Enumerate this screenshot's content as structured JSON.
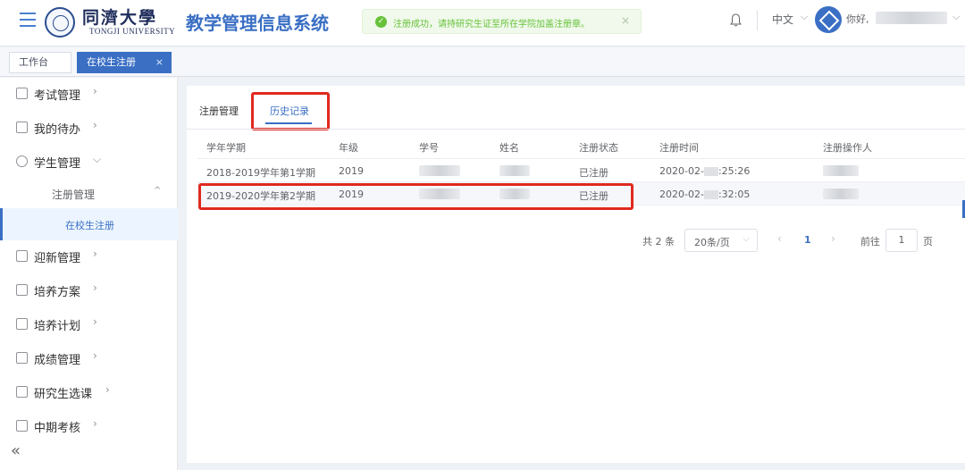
{
  "header": {
    "logo_cn": "同濟大學",
    "logo_en": "TONGJI UNIVERSITY",
    "system_title": "教学管理信息系统",
    "toast": "注册成功，请持研究生证至所在学院加盖注册章。",
    "language": "中文",
    "greeting": "你好,"
  },
  "tabs": [
    {
      "label": "工作台"
    },
    {
      "label": "在校生注册"
    }
  ],
  "sidebar": {
    "items": [
      {
        "label": "考试管理"
      },
      {
        "label": "我的待办"
      },
      {
        "label": "学生管理"
      },
      {
        "label": "迎新管理"
      },
      {
        "label": "培养方案"
      },
      {
        "label": "培养计划"
      },
      {
        "label": "成绩管理"
      },
      {
        "label": "研究生选课"
      },
      {
        "label": "中期考核"
      }
    ],
    "sub_item": "注册管理",
    "leaf_item": "在校生注册",
    "collapse": "«"
  },
  "main": {
    "inner_tabs": [
      "注册管理",
      "历史记录"
    ],
    "columns": [
      "学年学期",
      "年级",
      "学号",
      "姓名",
      "注册状态",
      "注册时间",
      "注册操作人"
    ],
    "rows": [
      {
        "term": "2018-2019学年第1学期",
        "grade": "2019",
        "status": "已注册",
        "time_prefix": "2020-02-",
        "time_suffix": ":25:26"
      },
      {
        "term": "2019-2020学年第2学期",
        "grade": "2019",
        "status": "已注册",
        "time_prefix": "2020-02-",
        "time_suffix": ":32:05"
      }
    ],
    "pagination": {
      "total": "共 2 条",
      "page_size": "20条/页",
      "current_page": "1",
      "goto_label": "前往",
      "goto_value": "1",
      "page_unit": "页"
    }
  },
  "colors": {
    "accent": "#3a6fc4",
    "success": "#67c23a",
    "highlight": "#e0291f"
  }
}
